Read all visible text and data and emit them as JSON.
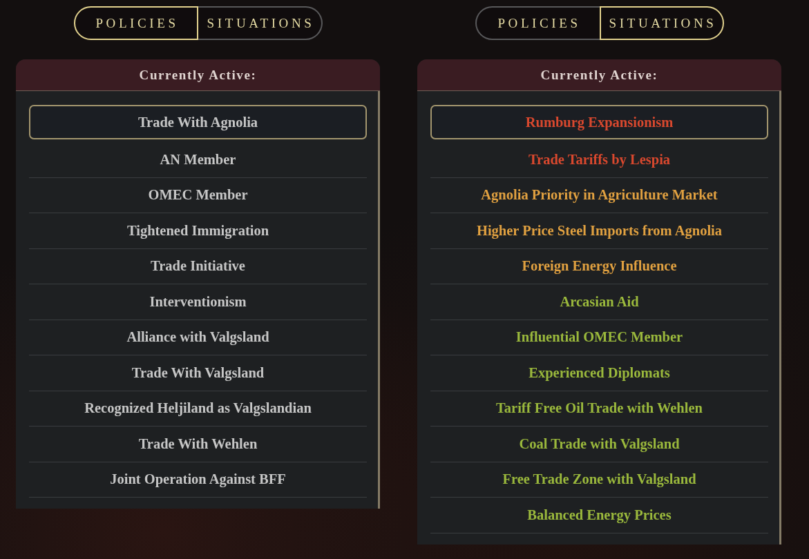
{
  "panels": [
    {
      "tabs": [
        {
          "label": "POLICIES",
          "selected": true
        },
        {
          "label": "SITUATIONS",
          "selected": false
        }
      ],
      "header": "Currently Active:",
      "items": [
        {
          "label": "Trade With Agnolia",
          "selected": true
        },
        {
          "label": "AN Member",
          "selected": false
        },
        {
          "label": "OMEC Member",
          "selected": false
        },
        {
          "label": "Tightened Immigration",
          "selected": false
        },
        {
          "label": "Trade Initiative",
          "selected": false
        },
        {
          "label": "Interventionism",
          "selected": false
        },
        {
          "label": "Alliance with Valgsland",
          "selected": false
        },
        {
          "label": "Trade With Valgsland",
          "selected": false
        },
        {
          "label": "Recognized Heljiland as Valgslandian",
          "selected": false
        },
        {
          "label": "Trade With Wehlen",
          "selected": false
        },
        {
          "label": "Joint Operation Against BFF",
          "selected": false
        }
      ]
    },
    {
      "tabs": [
        {
          "label": "POLICIES",
          "selected": false
        },
        {
          "label": "SITUATIONS",
          "selected": true
        }
      ],
      "header": "Currently Active:",
      "items": [
        {
          "label": "Rumburg Expansionism",
          "selected": true,
          "color": "#d9482e"
        },
        {
          "label": "Trade Tariffs by Lespia",
          "selected": false,
          "color": "#d9482e"
        },
        {
          "label": "Agnolia Priority in Agriculture Market",
          "selected": false,
          "color": "#e0a040"
        },
        {
          "label": "Higher Price Steel Imports from Agnolia",
          "selected": false,
          "color": "#e0a040"
        },
        {
          "label": "Foreign Energy Influence",
          "selected": false,
          "color": "#e0a040"
        },
        {
          "label": "Arcasian Aid",
          "selected": false,
          "color": "#9ab83c"
        },
        {
          "label": "Influential OMEC Member",
          "selected": false,
          "color": "#9ab83c"
        },
        {
          "label": "Experienced Diplomats",
          "selected": false,
          "color": "#9ab83c"
        },
        {
          "label": "Tariff Free Oil Trade with Wehlen",
          "selected": false,
          "color": "#9ab83c"
        },
        {
          "label": "Coal Trade with Valgsland",
          "selected": false,
          "color": "#9ab83c"
        },
        {
          "label": "Free Trade Zone with Valgsland",
          "selected": false,
          "color": "#9ab83c"
        },
        {
          "label": "Balanced Energy Prices",
          "selected": false,
          "color": "#9ab83c"
        }
      ]
    }
  ]
}
